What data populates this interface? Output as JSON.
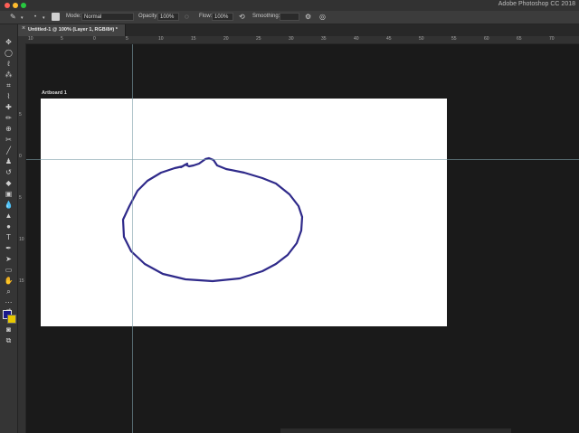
{
  "app": {
    "title": "Adobe Photoshop CC 2018",
    "traffic_lights": [
      "#fe5f57",
      "#febc2e",
      "#28c840"
    ]
  },
  "options_bar": {
    "mode_label": "Mode:",
    "mode_value": "Normal",
    "opacity_label": "Opacity:",
    "opacity_value": "100%",
    "flow_label": "Flow:",
    "flow_value": "100%",
    "smoothing_label": "Smoothing:",
    "smoothing_value": ""
  },
  "document": {
    "tab_title": "Untitled-1 @ 100% (Layer 1, RGB/8#) *",
    "artboard_label": "Artboard 1"
  },
  "rulers": {
    "top_labels": [
      "10",
      "5",
      "0",
      "5",
      "10",
      "15",
      "20",
      "25",
      "30",
      "35",
      "40",
      "45",
      "50",
      "55",
      "60",
      "65",
      "70"
    ],
    "left_labels": [
      "5",
      "0",
      "5",
      "10",
      "15"
    ]
  },
  "colors": {
    "foreground": "#1a1a8c",
    "background": "#e8c800",
    "stroke": "#2f2a8a"
  },
  "tools": [
    "move-icon",
    "marquee-icon",
    "lasso-icon",
    "magic-wand-icon",
    "crop-icon",
    "eyedropper-icon",
    "healing-icon",
    "brush-icon",
    "clone-stamp-icon",
    "history-brush-icon",
    "eraser-icon",
    "gradient-icon",
    "blur-icon",
    "dodge-icon",
    "pen-icon",
    "type-icon",
    "path-select-icon",
    "shape-icon",
    "hand-icon",
    "zoom-icon",
    "more-icon"
  ]
}
